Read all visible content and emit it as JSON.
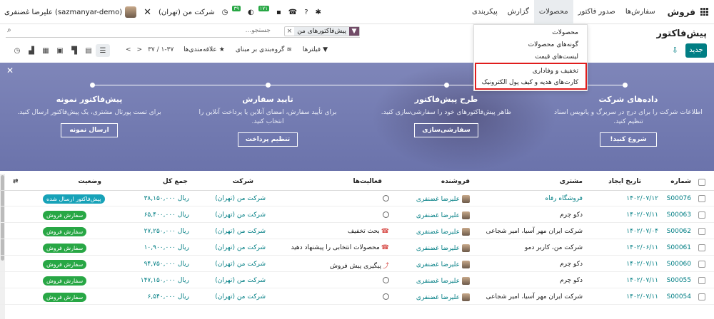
{
  "navbar": {
    "app_name": "فروش",
    "menu": [
      "سفارش‌ها",
      "صدور فاکتور",
      "محصولات",
      "گزارش",
      "پیکربندی"
    ],
    "company": "شرکت من (تهران)",
    "user": "علیرضا غضنفری (sazmanyar-demo)",
    "badge_activity": "۱۷۱",
    "badge_timer": "۳۹"
  },
  "dropdown": {
    "items": [
      "محصولات",
      "گونه‌های محصولات",
      "لیست‌های قیمت",
      "تخفیف و وفاداری",
      "کارت‌های هدیه و کیف پول الکترونیک"
    ]
  },
  "control": {
    "title": "پیش‌فاکتور",
    "new_button": "جدید",
    "facet": "پیش‌فاکتورهای من",
    "search_placeholder": "جستجو...",
    "filters": "فیلترها",
    "group_by": "گروه‌بندی بر مبنای",
    "favorites": "علاقه‌مندی‌ها",
    "pager": "۱-۳۷ / ۳۷"
  },
  "banner": {
    "steps": [
      {
        "title": "داده‌های شرکت",
        "text": "اطلاعات شرکت را برای درج در سربرگ و پانویس اسناد تنظیم کنید.",
        "button": "شروع کنید!"
      },
      {
        "title": "طرح پیش‌فاکتور",
        "text": "ظاهر پیش‌فاکتورهای خود را سفارشی‌سازی کنید.",
        "button": "سفارشی‌سازی"
      },
      {
        "title": "تایید سفارش",
        "text": "برای تأیید سفارش، امضای آنلاین یا پرداخت آنلاین را انتخاب کنید.",
        "button": "تنظیم پرداخت"
      },
      {
        "title": "پیش‌فاکتور نمونه",
        "text": "برای تست پورتال مشتری، یک پیش‌فاکتور ارسال کنید.",
        "button": "ارسال نمونه"
      }
    ]
  },
  "table": {
    "headers": {
      "number": "شماره",
      "date": "تاریخ ایجاد",
      "customer": "مشتری",
      "salesperson": "فروشنده",
      "activities": "فعالیت‌ها",
      "company": "شرکت",
      "total": "جمع کل",
      "status": "وضعیت"
    },
    "rows": [
      {
        "number": "S00076",
        "date": "۱۴۰۲/۰۷/۱۲",
        "customer": "فروشگاه رفاه",
        "salesperson": "علیرضا غضنفری",
        "activity": "",
        "company": "شرکت من (تهران)",
        "total": "ریال ۳۸,۱۵۰,۰۰۰",
        "status": "پیش‌فاکتور ارسال شده",
        "status_type": "blue"
      },
      {
        "number": "S00063",
        "date": "۱۴۰۲/۰۷/۱۱",
        "customer": "دکو چرم",
        "salesperson": "علیرضا غضنفری",
        "activity": "",
        "company": "شرکت من (تهران)",
        "total": "ریال ۶۵,۴۰۰,۰۰۰",
        "status": "سفارش فروش",
        "status_type": "green"
      },
      {
        "number": "S00062",
        "date": "۱۴۰۲/۰۷/۰۴",
        "customer": "شرکت ایران مهر آسیا، امیر شجاعی",
        "salesperson": "علیرضا غضنفری",
        "activity": "بحث تخفیف",
        "company": "شرکت من (تهران)",
        "total": "ریال ۲۷,۲۵۰,۰۰۰",
        "status": "سفارش فروش",
        "status_type": "green"
      },
      {
        "number": "S00061",
        "date": "۱۴۰۲/۰۶/۱۱",
        "customer": "شرکت من، کاربر دمو",
        "salesperson": "علیرضا غضنفری",
        "activity": "محصولات انتخابی را پیشنهاد دهید",
        "company": "شرکت من (تهران)",
        "total": "ریال ۱۰,۹۰۰,۰۰۰",
        "status": "سفارش فروش",
        "status_type": "green"
      },
      {
        "number": "S00060",
        "date": "۱۴۰۲/۰۷/۱۱",
        "customer": "دکو چرم",
        "salesperson": "علیرضا غضنفری",
        "activity": "پیگیری پیش فروش",
        "company": "شرکت من (تهران)",
        "total": "ریال ۹۴,۷۵۰,۰۰۰",
        "status": "سفارش فروش",
        "status_type": "green"
      },
      {
        "number": "S00055",
        "date": "۱۴۰۲/۰۷/۱۱",
        "customer": "دکو چرم",
        "salesperson": "علیرضا غضنفری",
        "activity": "",
        "company": "شرکت من (تهران)",
        "total": "ریال ۱۴۷,۱۵۰,۰۰۰",
        "status": "سفارش فروش",
        "status_type": "green"
      },
      {
        "number": "S00054",
        "date": "۱۴۰۲/۰۷/۱۱",
        "customer": "شرکت ایران مهر آسیا، امیر شجاعی",
        "salesperson": "علیرضا غضنفری",
        "activity": "",
        "company": "شرکت من (تهران)",
        "total": "ریال ۶,۵۴۰,۰۰۰",
        "status": "سفارش فروش",
        "status_type": "green"
      }
    ]
  }
}
